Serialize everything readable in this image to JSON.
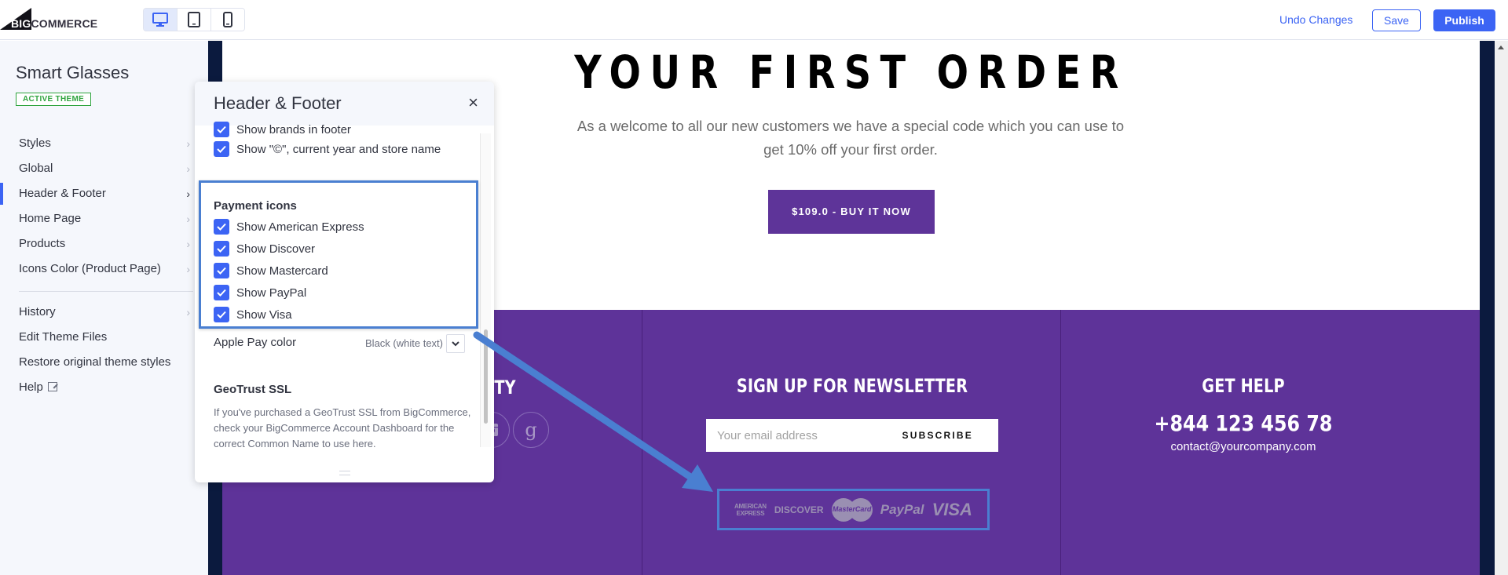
{
  "topbar": {
    "logo_big": "BIG",
    "logo_rest": "COMMERCE",
    "devices": [
      {
        "name": "desktop",
        "active": true
      },
      {
        "name": "tablet",
        "active": false
      },
      {
        "name": "mobile",
        "active": false
      }
    ],
    "undo_label": "Undo Changes",
    "save_label": "Save",
    "publish_label": "Publish"
  },
  "sidebar": {
    "store_name": "Smart Glasses",
    "badge": "ACTIVE THEME",
    "items": [
      {
        "label": "Styles",
        "chevron": true,
        "active": false
      },
      {
        "label": "Global",
        "chevron": true,
        "active": false
      },
      {
        "label": "Header & Footer",
        "chevron": true,
        "active": true
      },
      {
        "label": "Home Page",
        "chevron": true,
        "active": false
      },
      {
        "label": "Products",
        "chevron": true,
        "active": false
      },
      {
        "label": "Icons Color (Product Page)",
        "chevron": true,
        "active": false
      }
    ],
    "secondary_items": [
      {
        "label": "History",
        "chevron": true
      },
      {
        "label": "Edit Theme Files",
        "chevron": false
      },
      {
        "label": "Restore original theme styles",
        "chevron": false
      },
      {
        "label": "Help",
        "external": true
      }
    ]
  },
  "panel": {
    "title": "Header & Footer",
    "close_icon": "×",
    "footer_checks": [
      {
        "label": "Show brands in footer",
        "checked": true
      },
      {
        "label": "Show \"©\", current year and store name",
        "checked": true
      }
    ],
    "payment_section_label": "Payment icons",
    "payment_checks": [
      {
        "label": "Show American Express",
        "checked": true
      },
      {
        "label": "Show Discover",
        "checked": true
      },
      {
        "label": "Show Mastercard",
        "checked": true
      },
      {
        "label": "Show PayPal",
        "checked": true
      },
      {
        "label": "Show Visa",
        "checked": true
      }
    ],
    "apple_pay": {
      "label": "Apple Pay color",
      "value": "Black (white text)"
    },
    "geotrust": {
      "title": "GeoTrust SSL",
      "text": "If you've purchased a GeoTrust SSL from BigCommerce, check your BigCommerce Account Dashboard for the correct Common Name to use here."
    }
  },
  "preview": {
    "hero_title": "YOUR FIRST ORDER",
    "hero_text": "As a welcome to all our new customers we have a special code which you can use to get 10% off your first order.",
    "buy_button": "$109.0 - BUY IT NOW",
    "footer": {
      "col1_title_partial": "TY",
      "social": [
        "instagram",
        "google"
      ],
      "newsletter_title": "SIGN UP FOR NEWSLETTER",
      "email_placeholder": "Your email address",
      "subscribe_label": "SUBSCRIBE",
      "help_title": "GET HELP",
      "phone": "+844 123 456 78",
      "email": "contact@yourcompany.com",
      "payment_icons": [
        {
          "name": "american-express",
          "text": "AMERICAN EXPRESS"
        },
        {
          "name": "discover",
          "text": "DISCOVER"
        },
        {
          "name": "mastercard",
          "text": "MasterCard"
        },
        {
          "name": "paypal",
          "text": "PayPal"
        },
        {
          "name": "visa",
          "text": "VISA"
        }
      ]
    }
  },
  "colors": {
    "accent": "#3c64f4",
    "brand_purple": "#5e3399",
    "annotation_blue": "#4a7fd1",
    "badge_green": "#2fa43e",
    "preview_frame": "#0b1a3e"
  }
}
